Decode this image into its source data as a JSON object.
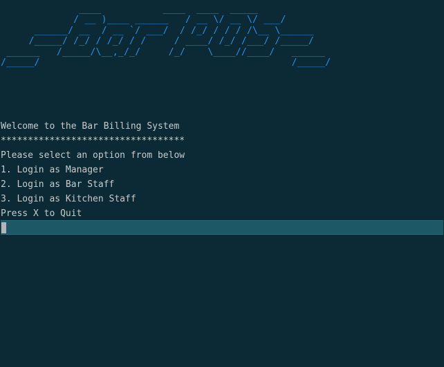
{
  "terminal": {
    "banner": "              ____           ____  ____  _____\n             / __ )____ ______   / __ \\/ __ \\/ ___/\n      ______/ __  / __ `/ ___/  / /_/ / / / /\\__ \\______\n     /_____/ /_/ / /_/ / /     / ____/ /_/ /___/ /_____/\n ______   /_____/\\__,_/_/     /_/    \\____//____/   ______\n/_____/                                             /_____/",
    "lines": {
      "welcome": "Welcome to the Bar Billing System",
      "separator": "**********************************",
      "select": "Please select an option from below",
      "option1": "1. Login as Manager",
      "option2": "2. Login as Bar Staff",
      "option3": "3. Login as Kitchen Staff",
      "quit": "Press X to Quit"
    },
    "input_value": "",
    "colors": {
      "background": "#0b2a35",
      "banner": "#2b8fdc",
      "text": "#c6cccb",
      "prompt_highlight": "#1c5866"
    }
  }
}
